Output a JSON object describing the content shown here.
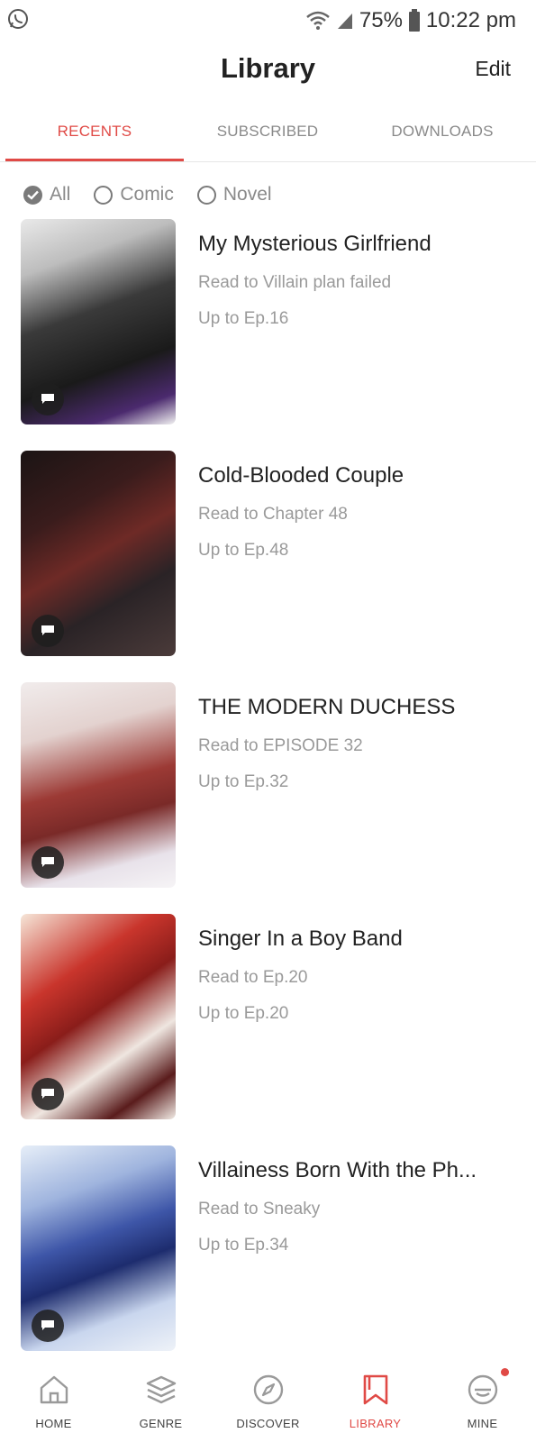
{
  "status_bar": {
    "battery": "75%",
    "time": "10:22 pm",
    "icons": [
      "whatsapp-icon",
      "wifi-icon",
      "signal-icon",
      "battery-icon"
    ]
  },
  "header": {
    "title": "Library",
    "edit_label": "Edit"
  },
  "tabs": [
    {
      "label": "RECENTS",
      "active": true
    },
    {
      "label": "SUBSCRIBED",
      "active": false
    },
    {
      "label": "DOWNLOADS",
      "active": false
    }
  ],
  "filters": [
    {
      "label": "All",
      "checked": true
    },
    {
      "label": "Comic",
      "checked": false
    },
    {
      "label": "Novel",
      "checked": false
    }
  ],
  "items": [
    {
      "title": "My Mysterious Girlfriend",
      "read": "Read to Villain plan failed",
      "up_to": "Up to Ep.16"
    },
    {
      "title": "Cold-Blooded Couple",
      "read": "Read to Chapter 48",
      "up_to": "Up to Ep.48"
    },
    {
      "title": "THE MODERN DUCHESS",
      "read": "Read to EPISODE 32",
      "up_to": "Up to Ep.32"
    },
    {
      "title": "Singer In a Boy Band",
      "read": "Read to Ep.20",
      "up_to": "Up to Ep.20"
    },
    {
      "title": "Villainess Born With the Ph...",
      "read": "Read to Sneaky",
      "up_to": "Up to Ep.34"
    }
  ],
  "bottom_nav": [
    {
      "label": "HOME",
      "icon": "home-icon",
      "active": false
    },
    {
      "label": "GENRE",
      "icon": "layers-icon",
      "active": false
    },
    {
      "label": "DISCOVER",
      "icon": "compass-icon",
      "active": false
    },
    {
      "label": "LIBRARY",
      "icon": "bookmark-icon",
      "active": true
    },
    {
      "label": "MINE",
      "icon": "profile-icon",
      "active": false,
      "notification": true
    }
  ],
  "colors": {
    "accent": "#e04a46",
    "muted_text": "#9a9a9a",
    "title_text": "#222222"
  }
}
